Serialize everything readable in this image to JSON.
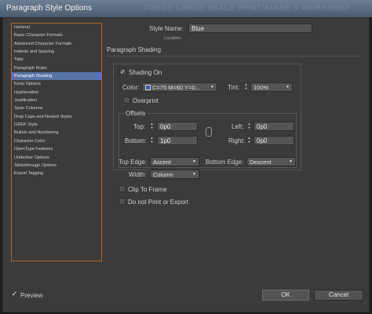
{
  "window": {
    "title": "Paragraph Style Options",
    "ghost_text": "...  FONDO LARGE-SCALE PRINTMAKER'S WORKSHOP"
  },
  "categories": [
    {
      "label": "General"
    },
    {
      "label": "Basic Character Formats"
    },
    {
      "label": "Advanced Character Formats"
    },
    {
      "label": "Indents and Spacing"
    },
    {
      "label": "Tabs"
    },
    {
      "label": "Paragraph Rules"
    },
    {
      "label": "Paragraph Shading"
    },
    {
      "label": "Keep Options"
    },
    {
      "label": "Hyphenation"
    },
    {
      "label": "Justification"
    },
    {
      "label": "Span Columns"
    },
    {
      "label": "Drop Caps and Nested Styles"
    },
    {
      "label": "GREP Style"
    },
    {
      "label": "Bullets and Numbering"
    },
    {
      "label": "Character Color"
    },
    {
      "label": "OpenType Features"
    },
    {
      "label": "Underline Options"
    },
    {
      "label": "Strikethrough Options"
    },
    {
      "label": "Export Tagging"
    }
  ],
  "selected_category_index": 6,
  "style_name": {
    "label": "Style Name:",
    "value": "Blue"
  },
  "location": {
    "label": "Location:"
  },
  "section_title": "Paragraph Shading",
  "shading": {
    "shading_on_label": "Shading On",
    "shading_on_checked": true,
    "color_label": "Color:",
    "color_value": "C=75 M=60 Y=0...",
    "color_swatch": "#3b5fb0",
    "tint_label": "Tint:",
    "tint_value": "100%",
    "overprint_label": "Overprint",
    "overprint_checked": false
  },
  "offsets": {
    "legend": "Offsets",
    "top_label": "Top:",
    "top_value": "0p0",
    "bottom_label": "Bottom:",
    "bottom_value": "1p0",
    "left_label": "Left:",
    "left_value": "0p0",
    "right_label": "Right:",
    "right_value": "0p0"
  },
  "edges": {
    "top_edge_label": "Top Edge:",
    "top_edge_value": "Ascent",
    "bottom_edge_label": "Bottom Edge:",
    "bottom_edge_value": "Descent",
    "width_label": "Width:",
    "width_value": "Column"
  },
  "clip_to_frame": {
    "label": "Clip To Frame",
    "checked": false
  },
  "no_print": {
    "label": "Do not Print or Export",
    "checked": false
  },
  "preview": {
    "label": "Preview",
    "checked": true
  },
  "buttons": {
    "ok": "OK",
    "cancel": "Cancel"
  },
  "icons": {
    "checkmark": "✓",
    "dropdown": "▼",
    "spinner": "▲▼",
    "link": "chain-link-icon"
  }
}
